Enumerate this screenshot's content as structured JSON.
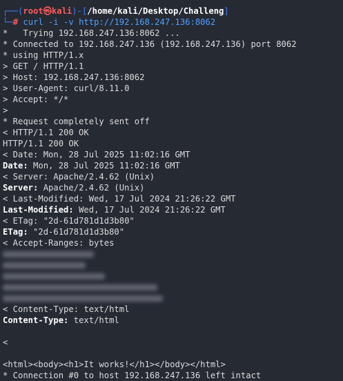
{
  "prompt": {
    "user": "root",
    "at": "㉿",
    "host": "kali",
    "path": "/home/kali/Desktop/Challeng",
    "symbol": "#",
    "command": "curl -i -v http://192.168.247.136:8062"
  },
  "lines": [
    "*   Trying 192.168.247.136:8062 ...",
    "* Connected to 192.168.247.136 (192.168.247.136) port 8062",
    "* using HTTP/1.x",
    "> GET / HTTP/1.1",
    "> Host: 192.168.247.136:8062",
    "> User-Agent: curl/8.11.0",
    "> Accept: */*",
    ">",
    "* Request completely sent off",
    "< HTTP/1.1 200 OK",
    "HTTP/1.1 200 OK",
    "< Date: Mon, 28 Jul 2025 11:02:16 GMT"
  ],
  "headers": [
    {
      "key": "Date:",
      "value": " Mon, 28 Jul 2025 11:02:16 GMT"
    },
    {
      "raw": "< Server: Apache/2.4.62 (Unix)"
    },
    {
      "key": "Server:",
      "value": " Apache/2.4.62 (Unix)"
    },
    {
      "raw": "< Last-Modified: Wed, 17 Jul 2024 21:26:22 GMT"
    },
    {
      "key": "Last-Modified:",
      "value": " Wed, 17 Jul 2024 21:26:22 GMT"
    },
    {
      "raw": "< ETag: \"2d-61d781d1d3b80\""
    },
    {
      "key": "ETag:",
      "value": " \"2d-61d781d1d3b80\""
    },
    {
      "raw": "< Accept-Ranges: bytes"
    }
  ],
  "after": {
    "ct_raw": "< Content-Type: text/html",
    "ct_key": "Content-Type:",
    "ct_value": " text/html",
    "lt": "<",
    "html": "<html><body><h1>It works!</h1></body></html>",
    "closing": "* Connection #0 to host 192.168.247.136 left intact"
  }
}
